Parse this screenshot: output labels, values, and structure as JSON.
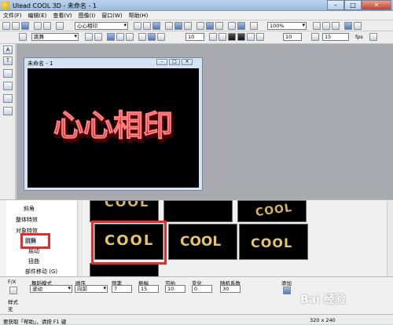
{
  "window": {
    "title": "Ulead COOL 3D - 未命名 - 1",
    "minimize": "–",
    "maximize": "□",
    "close": "✕"
  },
  "menu": [
    "文件(F)",
    "编辑(E)",
    "查看(V)",
    "图像(I)",
    "窗口(W)",
    "帮助(H)"
  ],
  "toolbar1": {
    "object_select": "心心相印",
    "zoom": "100%"
  },
  "toolbar2": {
    "effect_select": "跳舞",
    "frame_value": "10",
    "speed_value": "10",
    "fps_value": "15",
    "fps_label": "fps"
  },
  "document": {
    "title": "未命名 - 1",
    "min": "–",
    "max": "□",
    "close": "✕",
    "text3d": "心心相印"
  },
  "tree": {
    "items": [
      "斜角",
      "整体特效",
      "对象特效",
      "跳舞",
      "摇动",
      "扭曲",
      "部件移动 (G)"
    ],
    "highlight_item": "跳舞"
  },
  "thumbnails": {
    "row1": [
      "COOL",
      "",
      "COOL"
    ],
    "row2": [
      "COOL",
      "COOL",
      "COOL"
    ]
  },
  "props": {
    "fx_label": "F/X",
    "mode_label": "舞蹈模式",
    "mode_value": "波动",
    "order_label": "顺序",
    "order_value": "向前",
    "freq_label": "频率",
    "freq_value": "7",
    "amp_label": "振幅",
    "amp_value": "15",
    "beat_label": "节拍",
    "beat_value": "10",
    "change_label": "变化",
    "change_value": "0",
    "seed_label": "随机系数",
    "seed_value": "30",
    "add_label": "添加",
    "style_label": "样式",
    "style_value": "无"
  },
  "status": {
    "help": "要获取「帮助」，请按 F1 键",
    "size": "320 x 240"
  },
  "watermark": {
    "text": "Bai 经验"
  },
  "colors": {
    "accent": "#e32d2d",
    "text3d": "#e0141a",
    "gold": "#d8b55a"
  }
}
